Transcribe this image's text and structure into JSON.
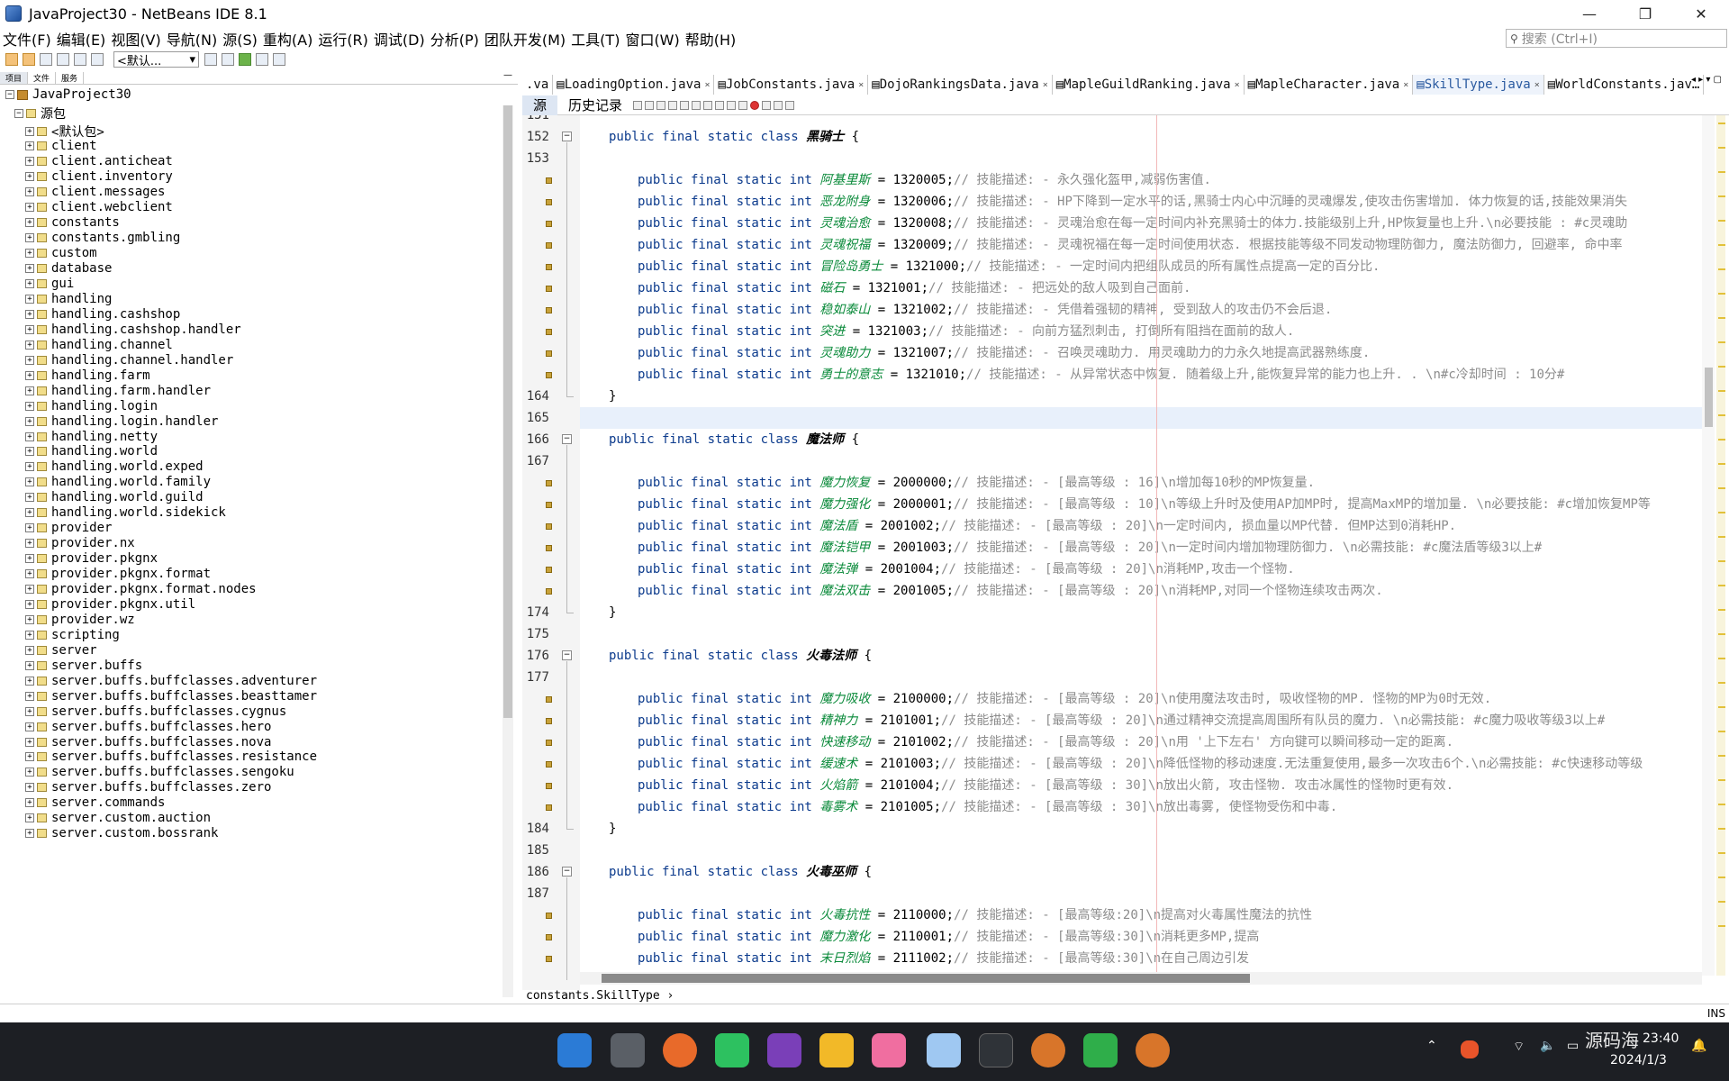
{
  "window": {
    "title": "JavaProject30 - NetBeans IDE 8.1"
  },
  "window_controls": {
    "minimize": "—",
    "maximize": "❐",
    "close": "✕"
  },
  "menu": [
    "文件(F)",
    "编辑(E)",
    "视图(V)",
    "导航(N)",
    "源(S)",
    "重构(A)",
    "运行(R)",
    "调试(D)",
    "分析(P)",
    "团队开发(M)",
    "工具(T)",
    "窗口(W)",
    "帮助(H)"
  ],
  "search": {
    "placeholder": "搜索 (Ctrl+I)"
  },
  "toolbar": {
    "config": "<默认..."
  },
  "left_tabs": [
    "项目",
    "文件",
    "服务"
  ],
  "project": {
    "name": "JavaProject30",
    "source_root": "源包",
    "packages": [
      "<默认包>",
      "client",
      "client.anticheat",
      "client.inventory",
      "client.messages",
      "client.webclient",
      "constants",
      "constants.gmbling",
      "custom",
      "database",
      "gui",
      "handling",
      "handling.cashshop",
      "handling.cashshop.handler",
      "handling.channel",
      "handling.channel.handler",
      "handling.farm",
      "handling.farm.handler",
      "handling.login",
      "handling.login.handler",
      "handling.netty",
      "handling.world",
      "handling.world.exped",
      "handling.world.family",
      "handling.world.guild",
      "handling.world.sidekick",
      "provider",
      "provider.nx",
      "provider.pkgnx",
      "provider.pkgnx.format",
      "provider.pkgnx.format.nodes",
      "provider.pkgnx.util",
      "provider.wz",
      "scripting",
      "server",
      "server.buffs",
      "server.buffs.buffclasses.adventurer",
      "server.buffs.buffclasses.beasttamer",
      "server.buffs.buffclasses.cygnus",
      "server.buffs.buffclasses.hero",
      "server.buffs.buffclasses.nova",
      "server.buffs.buffclasses.resistance",
      "server.buffs.buffclasses.sengoku",
      "server.buffs.buffclasses.zero",
      "server.commands",
      "server.custom.auction",
      "server.custom.bossrank"
    ]
  },
  "editor_tabs": [
    {
      "label": ".va",
      "active": false
    },
    {
      "label": "LoadingOption.java",
      "active": false
    },
    {
      "label": "JobConstants.java",
      "active": false
    },
    {
      "label": "DojoRankingsData.java",
      "active": false
    },
    {
      "label": "MapleGuildRanking.java",
      "active": false
    },
    {
      "label": "MapleCharacter.java",
      "active": false
    },
    {
      "label": "SkillType.java",
      "active": true
    },
    {
      "label": "WorldConstants.jav…",
      "active": false
    }
  ],
  "editor_subtabs": [
    "源",
    "历史记录"
  ],
  "code": [
    {
      "ln": "151",
      "type": "partial"
    },
    {
      "ln": "152",
      "type": "class",
      "name": "黑骑士"
    },
    {
      "ln": "153",
      "type": "blank"
    },
    {
      "ln": "",
      "type": "field",
      "name": "阿基里斯",
      "value": "1320005",
      "comment": "// 技能描述: - 永久强化盔甲,减弱伤害值."
    },
    {
      "ln": "",
      "type": "field",
      "name": "恶龙附身",
      "value": "1320006",
      "comment": "// 技能描述: - HP下降到一定水平的话,黑骑士内心中沉睡的灵魂爆发,使攻击伤害增加. 体力恢复的话,技能效果消失"
    },
    {
      "ln": "",
      "type": "field",
      "name": "灵魂治愈",
      "value": "1320008",
      "comment": "// 技能描述: - 灵魂治愈在每一定时间内补充黑骑士的体力.技能级别上升,HP恢复量也上升.\\n必要技能 : #c灵魂助"
    },
    {
      "ln": "",
      "type": "field",
      "name": "灵魂祝福",
      "value": "1320009",
      "comment": "// 技能描述: - 灵魂祝福在每一定时间使用状态. 根据技能等级不同发动物理防御力, 魔法防御力, 回避率, 命中率"
    },
    {
      "ln": "",
      "type": "field",
      "name": "冒险岛勇士",
      "value": "1321000",
      "comment": "// 技能描述: - 一定时间内把组队成员的所有属性点提高一定的百分比."
    },
    {
      "ln": "",
      "type": "field",
      "name": "磁石",
      "value": "1321001",
      "comment": "// 技能描述: - 把远处的敌人吸到自己面前."
    },
    {
      "ln": "",
      "type": "field",
      "name": "稳如泰山",
      "value": "1321002",
      "comment": "// 技能描述: - 凭借着强韧的精神, 受到敌人的攻击仍不会后退."
    },
    {
      "ln": "",
      "type": "field",
      "name": "突进",
      "value": "1321003",
      "comment": "// 技能描述: - 向前方猛烈刺击, 打倒所有阻挡在面前的敌人."
    },
    {
      "ln": "",
      "type": "field",
      "name": "灵魂助力",
      "value": "1321007",
      "comment": "// 技能描述: - 召唤灵魂助力. 用灵魂助力的力永久地提高武器熟练度."
    },
    {
      "ln": "",
      "type": "field",
      "name": "勇士的意志",
      "value": "1321010",
      "comment": "// 技能描述: - 从异常状态中恢复. 随着级上升,能恢复异常的能力也上升. . \\n#c冷却时间 : 10分#"
    },
    {
      "ln": "164",
      "type": "close"
    },
    {
      "ln": "165",
      "type": "blank"
    },
    {
      "ln": "166",
      "type": "class",
      "name": "魔法师"
    },
    {
      "ln": "167",
      "type": "blank"
    },
    {
      "ln": "",
      "type": "field",
      "name": "魔力恢复",
      "value": "2000000",
      "comment": "// 技能描述: - [最高等级 : 16]\\n增加每10秒的MP恢复量."
    },
    {
      "ln": "",
      "type": "field",
      "name": "魔力强化",
      "value": "2000001",
      "comment": "// 技能描述: - [最高等级 : 10]\\n等级上升时及使用AP加MP时, 提高MaxMP的增加量. \\n必要技能: #c增加恢复MP等"
    },
    {
      "ln": "",
      "type": "field",
      "name": "魔法盾",
      "value": "2001002",
      "comment": "// 技能描述: - [最高等级 : 20]\\n一定时间内, 损血量以MP代替. 但MP达到0消耗HP."
    },
    {
      "ln": "",
      "type": "field",
      "name": "魔法铠甲",
      "value": "2001003",
      "comment": "// 技能描述: - [最高等级 : 20]\\n一定时间内增加物理防御力. \\n必需技能: #c魔法盾等级3以上#"
    },
    {
      "ln": "",
      "type": "field",
      "name": "魔法弹",
      "value": "2001004",
      "comment": "// 技能描述: - [最高等级 : 20]\\n消耗MP,攻击一个怪物."
    },
    {
      "ln": "",
      "type": "field",
      "name": "魔法双击",
      "value": "2001005",
      "comment": "// 技能描述: - [最高等级 : 20]\\n消耗MP,对同一个怪物连续攻击两次."
    },
    {
      "ln": "174",
      "type": "close"
    },
    {
      "ln": "175",
      "type": "blank"
    },
    {
      "ln": "176",
      "type": "class",
      "name": "火毒法师"
    },
    {
      "ln": "177",
      "type": "blank"
    },
    {
      "ln": "",
      "type": "field",
      "name": "魔力吸收",
      "value": "2100000",
      "comment": "// 技能描述: - [最高等级 : 20]\\n使用魔法攻击时, 吸收怪物的MP. 怪物的MP为0时无效."
    },
    {
      "ln": "",
      "type": "field",
      "name": "精神力",
      "value": "2101001",
      "comment": "// 技能描述: - [最高等级 : 20]\\n通过精神交流提高周围所有队员的魔力. \\n必需技能: #c魔力吸收等级3以上#"
    },
    {
      "ln": "",
      "type": "field",
      "name": "快速移动",
      "value": "2101002",
      "comment": "// 技能描述: - [最高等级 : 20]\\n用 '上下左右' 方向键可以瞬间移动一定的距离."
    },
    {
      "ln": "",
      "type": "field",
      "name": "缓速术",
      "value": "2101003",
      "comment": "// 技能描述: - [最高等级 : 20]\\n降低怪物的移动速度.无法重复使用,最多一次攻击6个.\\n必需技能: #c快速移动等级"
    },
    {
      "ln": "",
      "type": "field",
      "name": "火焰箭",
      "value": "2101004",
      "comment": "// 技能描述: - [最高等级 : 30]\\n放出火箭, 攻击怪物. 攻击冰属性的怪物时更有效."
    },
    {
      "ln": "",
      "type": "field",
      "name": "毒雾术",
      "value": "2101005",
      "comment": "// 技能描述: - [最高等级 : 30]\\n放出毒雾, 使怪物受伤和中毒."
    },
    {
      "ln": "184",
      "type": "close"
    },
    {
      "ln": "185",
      "type": "blank"
    },
    {
      "ln": "186",
      "type": "class",
      "name": "火毒巫师"
    },
    {
      "ln": "187",
      "type": "blank"
    },
    {
      "ln": "",
      "type": "field",
      "name": "火毒抗性",
      "value": "2110000",
      "comment": "// 技能描述: - [最高等级:20]\\n提高对火毒属性魔法的抗性"
    },
    {
      "ln": "",
      "type": "field",
      "name": "魔力激化",
      "value": "2110001",
      "comment": "// 技能描述: - [最高等级:30]\\n消耗更多MP,提高"
    },
    {
      "ln": "",
      "type": "field",
      "name": "末日烈焰",
      "value": "2111002",
      "comment": "// 技能描述: - [最高等级:30]\\n在自己周边引发"
    }
  ],
  "code_tokens": {
    "mods": "public final static class ",
    "field_mods": "public final static int "
  },
  "breadcrumb": "constants.SkillType",
  "status": {
    "ins": "INS"
  },
  "taskbar": {
    "clock_time": "23:40",
    "clock_date": "2024/1/3",
    "watermark": "源码海"
  },
  "colors": {
    "keyword": "#0b3a8c",
    "field": "#0a8a3a",
    "comment": "#8c8c8c",
    "taskbar": "#1d1f24"
  }
}
